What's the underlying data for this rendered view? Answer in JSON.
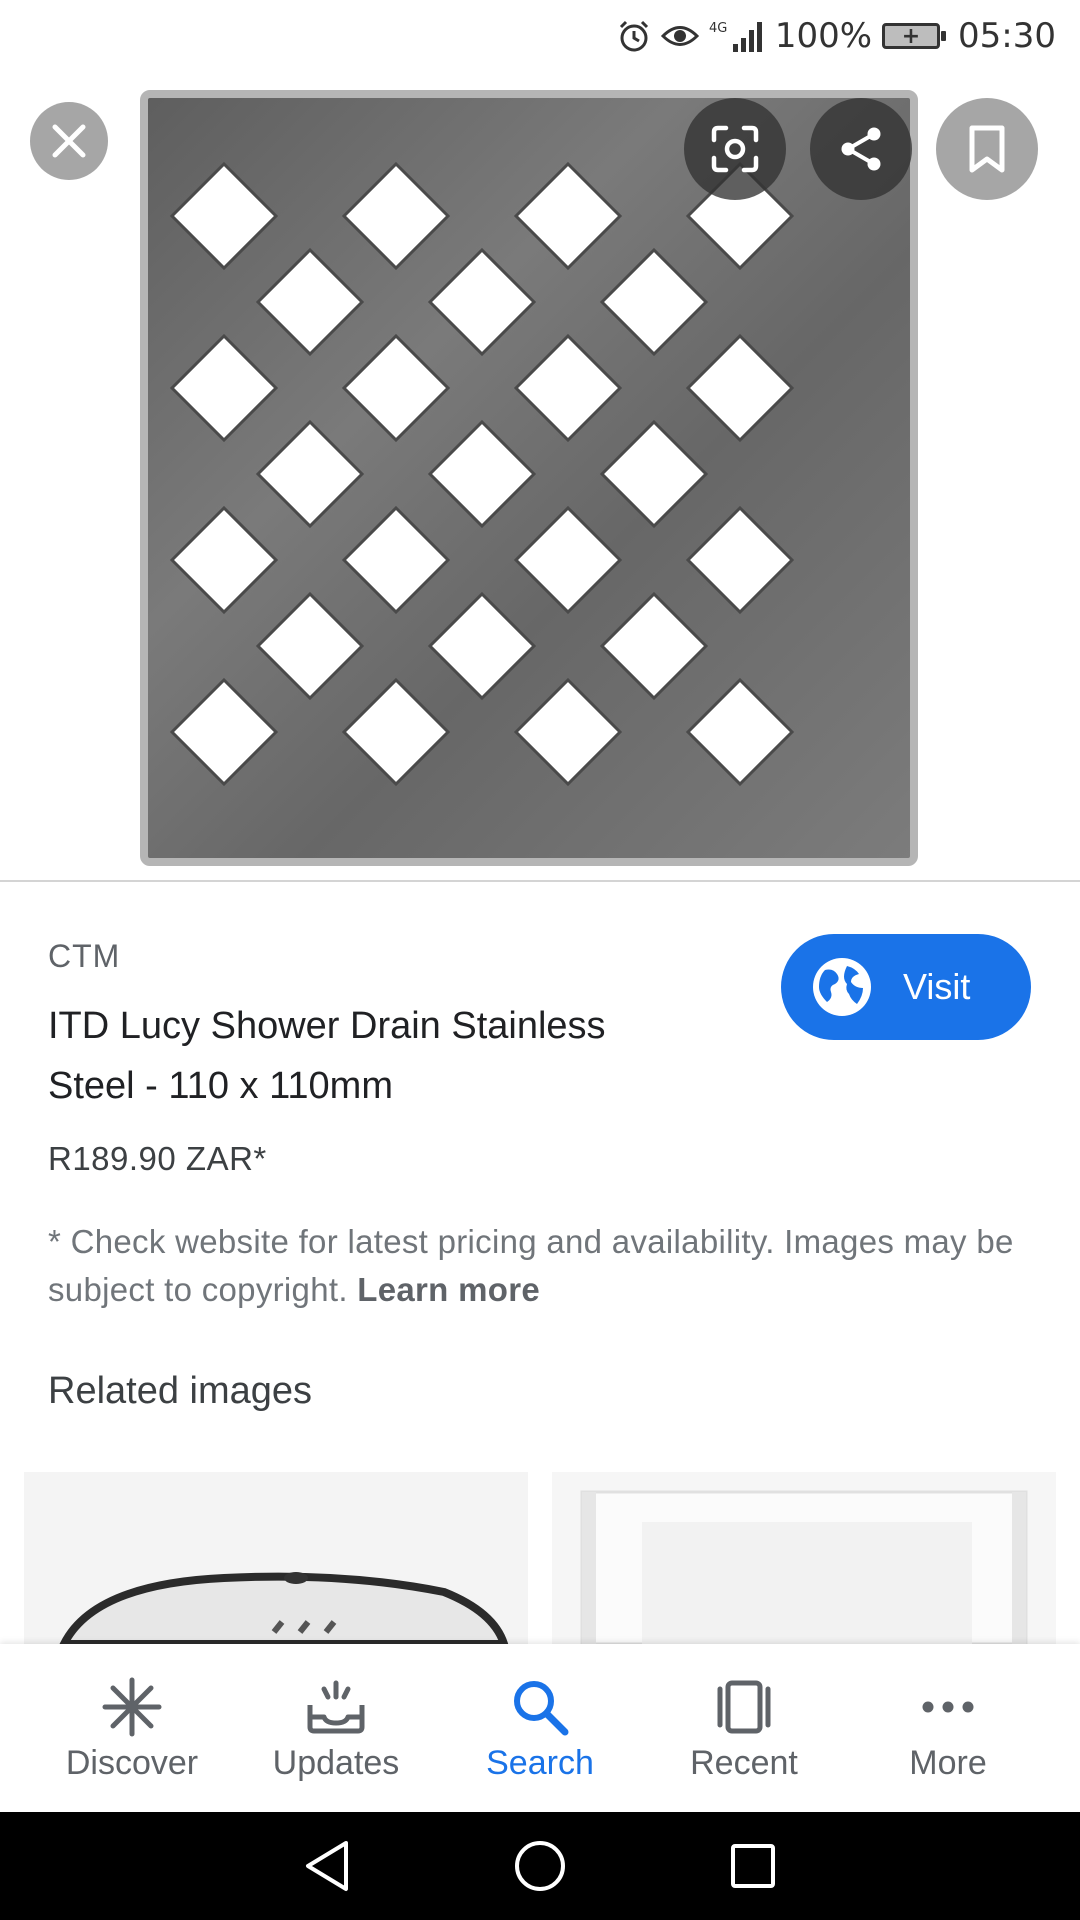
{
  "status_bar": {
    "network": "4G",
    "battery_percent": "100%",
    "time": "05:30",
    "icons": [
      "alarm-icon",
      "eye-icon",
      "signal-icon",
      "battery-icon"
    ]
  },
  "viewer": {
    "actions": {
      "close_icon": "close-icon",
      "lens_icon": "lens-icon",
      "share_icon": "share-icon",
      "bookmark_icon": "bookmark-icon"
    }
  },
  "result": {
    "source": "CTM",
    "title": "ITD Lucy Shower Drain Stainless Steel - 110 x 110mm",
    "price": "R189.90 ZAR*",
    "visit_label": "Visit",
    "disclaimer_text": "* Check website for latest pricing and availability. Images may be subject to copyright. ",
    "learn_more": "Learn more",
    "related_heading": "Related images"
  },
  "bottom_nav": {
    "items": [
      {
        "label": "Discover",
        "icon": "asterisk-icon"
      },
      {
        "label": "Updates",
        "icon": "updates-tray-icon"
      },
      {
        "label": "Search",
        "icon": "search-icon"
      },
      {
        "label": "Recent",
        "icon": "recent-cards-icon"
      },
      {
        "label": "More",
        "icon": "more-dots-icon"
      }
    ],
    "active": "Search"
  },
  "system_nav": [
    "back-icon",
    "home-icon",
    "recents-icon"
  ],
  "colors": {
    "accent": "#1a73e8",
    "text_primary": "#202124",
    "text_secondary": "#70757a",
    "steel": "#6e6e6e"
  }
}
